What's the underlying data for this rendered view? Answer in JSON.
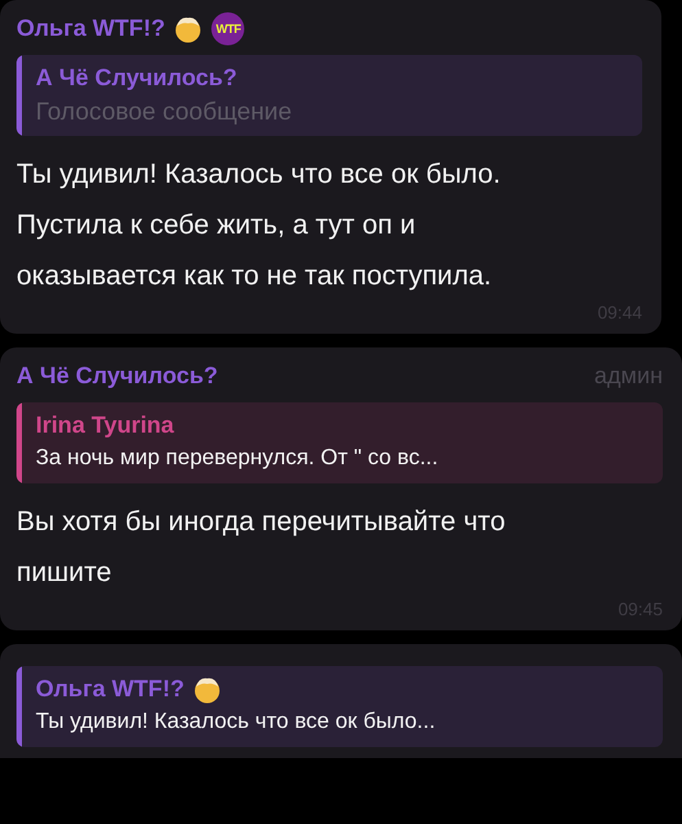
{
  "messages": [
    {
      "sender": "Ольга WTF!?",
      "sender_emoji": true,
      "badge": "WTF",
      "reply": {
        "author": "А Чё Случилось?",
        "author_emoji": false,
        "text": "Голосовое сообщение",
        "kind": "voice",
        "color": "#8b5bd8"
      },
      "text": "Ты удивил! Казалось что все ок было. Пустила к себе жить, а тут оп и оказывается как то не так поступила.",
      "time": "09:44"
    },
    {
      "sender": "А Чё Случилось?",
      "sender_emoji": false,
      "role": "админ",
      "reply": {
        "author": "Irina Tyurina",
        "author_emoji": false,
        "text": "За ночь мир перевернулся. От \" со вс...",
        "kind": "text",
        "color": "#d0468a"
      },
      "text": "Вы хотя бы иногда перечитывайте что пишите",
      "time": "09:45"
    },
    {
      "reply": {
        "author": "Ольга WTF!?",
        "author_emoji": true,
        "text": "Ты удивил! Казалось что все ок было...",
        "kind": "text",
        "color": "#8b5bd8"
      }
    }
  ]
}
